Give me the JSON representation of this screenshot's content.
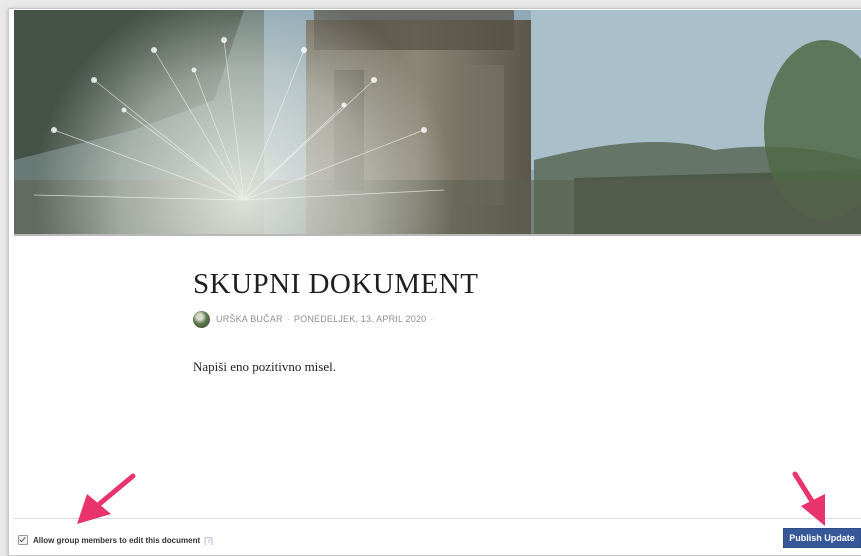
{
  "document": {
    "title": "SKUPNI DOKUMENT",
    "author": "URŠKA BUČAR",
    "separator": "·",
    "date": "PONEDELJEK, 13. APRIL 2020",
    "body": "Napiši eno pozitivno misel."
  },
  "footer": {
    "allow_edit_label": "Allow group members to edit this document",
    "allow_edit_checked": true,
    "help_label": "[?]",
    "publish_label": "Publish Update"
  },
  "colors": {
    "publish_button": "#365899",
    "annotation_arrow": "#e8336d"
  },
  "icons": {
    "cover": "dandelion-cover-photo",
    "avatar": "author-avatar",
    "arrows": "annotation-arrow-icon"
  }
}
